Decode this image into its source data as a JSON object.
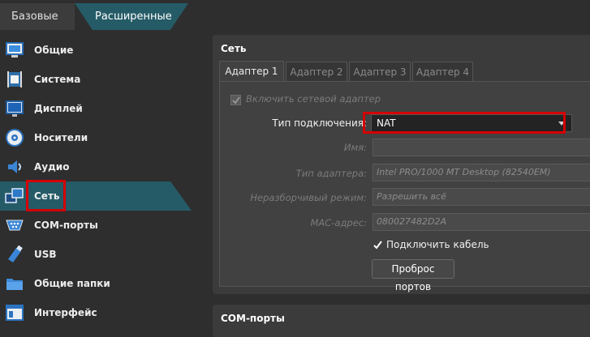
{
  "mode_tabs": {
    "basic": "Базовые",
    "advanced": "Расширенные"
  },
  "sidebar": {
    "items": [
      {
        "label": "Общие",
        "icon": "monitor-icon"
      },
      {
        "label": "Система",
        "icon": "chip-icon"
      },
      {
        "label": "Дисплей",
        "icon": "display-icon"
      },
      {
        "label": "Носители",
        "icon": "disk-icon"
      },
      {
        "label": "Аудио",
        "icon": "speaker-icon"
      },
      {
        "label": "Сеть",
        "icon": "network-icon"
      },
      {
        "label": "COM-порты",
        "icon": "serial-port-icon"
      },
      {
        "label": "USB",
        "icon": "usb-icon"
      },
      {
        "label": "Общие папки",
        "icon": "folder-icon"
      },
      {
        "label": "Интерфейс",
        "icon": "window-icon"
      }
    ],
    "active": "Сеть"
  },
  "network_panel": {
    "title": "Сеть",
    "tabs": [
      "Адаптер 1",
      "Адаптер 2",
      "Адаптер 3",
      "Адаптер 4"
    ],
    "enable_label": "Включить сетевой адаптер",
    "attached_label": "Тип подключения:",
    "attached_value": "NAT",
    "name_label": "Имя:",
    "adapter_type_label": "Тип адаптера:",
    "adapter_type_value": "Intel PRO/1000 MT Desktop (82540EM)",
    "promisc_label": "Неразборчивый режим:",
    "promisc_value": "Разрешить всё",
    "mac_label": "MAC-адрес:",
    "mac_value": "080027482D2A",
    "cable_label": "Подключить кабель",
    "port_forward_button": "Проброс портов"
  },
  "com_panel": {
    "title": "COM-порты"
  },
  "colors": {
    "accent": "#255b67",
    "highlight_box": "#d40000",
    "background": "#2e2e2e"
  }
}
